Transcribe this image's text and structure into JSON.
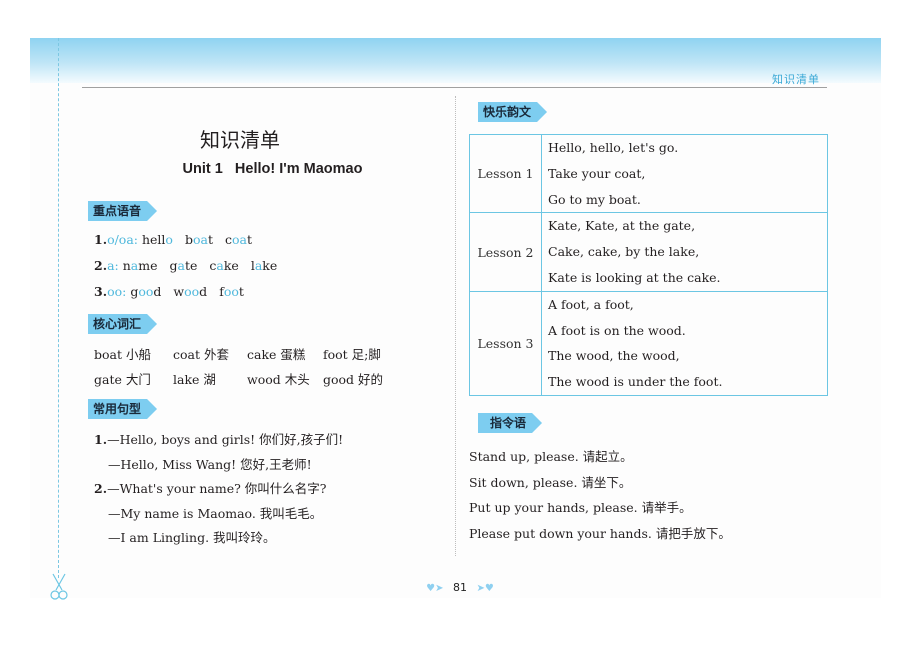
{
  "header": {
    "section_label": "知识清单"
  },
  "title": "知识清单",
  "unit_title": "Unit 1   Hello! I'm Maomao",
  "sections": {
    "pronunciation": {
      "tag": "重点语音",
      "items": [
        {
          "num": "1.",
          "key": "o/oa:",
          "words": [
            {
              "pre": "hell",
              "hl": "o",
              "post": ""
            },
            {
              "pre": "b",
              "hl": "oa",
              "post": "t"
            },
            {
              "pre": "c",
              "hl": "oa",
              "post": "t"
            }
          ]
        },
        {
          "num": "2.",
          "key": "a:",
          "words": [
            {
              "pre": "n",
              "hl": "a",
              "post": "me"
            },
            {
              "pre": "g",
              "hl": "a",
              "post": "te"
            },
            {
              "pre": "c",
              "hl": "a",
              "post": "ke"
            },
            {
              "pre": "l",
              "hl": "a",
              "post": "ke"
            }
          ]
        },
        {
          "num": "3.",
          "key": "oo:",
          "words": [
            {
              "pre": "g",
              "hl": "oo",
              "post": "d"
            },
            {
              "pre": "w",
              "hl": "oo",
              "post": "d"
            },
            {
              "pre": "f",
              "hl": "oo",
              "post": "t"
            }
          ]
        }
      ]
    },
    "vocabulary": {
      "tag": "核心词汇",
      "rows": [
        [
          "boat 小船",
          "coat 外套",
          "cake 蛋糕",
          "foot 足;脚"
        ],
        [
          "gate 大门",
          "lake 湖",
          "wood 木头",
          "good 好的"
        ]
      ]
    },
    "sentences": {
      "tag": "常用句型",
      "lines": [
        {
          "num": "1.",
          "text": "—Hello, boys and girls! 你们好,孩子们!"
        },
        {
          "num": "",
          "text": "—Hello, Miss Wang! 您好,王老师!"
        },
        {
          "num": "2.",
          "text": "—What's your name? 你叫什么名字?"
        },
        {
          "num": "",
          "text": "—My name is Maomao. 我叫毛毛。"
        },
        {
          "num": "",
          "text": "—I am Lingling. 我叫玲玲。"
        }
      ]
    },
    "rhymes": {
      "tag": "快乐韵文",
      "lessons": [
        {
          "label": "Lesson 1",
          "lines": [
            "Hello, hello, let's go.",
            "Take your coat,",
            "Go to my boat."
          ]
        },
        {
          "label": "Lesson 2",
          "lines": [
            "Kate, Kate, at the gate,",
            "Cake, cake, by the lake,",
            "Kate is looking at the cake."
          ]
        },
        {
          "label": "Lesson 3",
          "lines": [
            "A foot, a foot,",
            "A foot is on the wood.",
            "The wood, the wood,",
            "The wood is under the foot."
          ]
        }
      ]
    },
    "instructions": {
      "tag": "指令语",
      "lines": [
        "Stand up, please. 请起立。",
        "Sit down, please. 请坐下。",
        "Put up your hands, please. 请举手。",
        "Please put down your hands. 请把手放下。"
      ]
    }
  },
  "footer": {
    "page_number": "81"
  },
  "icons": {
    "cut_line": "scissors-icon",
    "footer_decoration": "heart-icon"
  }
}
